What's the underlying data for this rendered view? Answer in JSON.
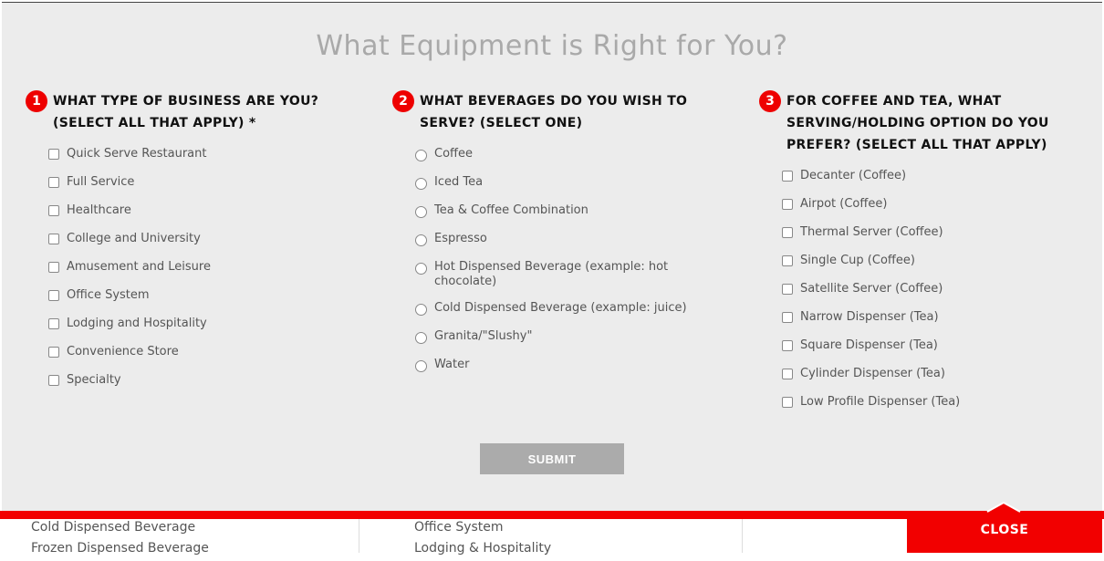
{
  "modal": {
    "title": "What Equipment is Right for You?",
    "questions": [
      {
        "number": "1",
        "text": "What type of business are you? (Select all that apply) *",
        "input_type": "checkbox",
        "options": [
          "Quick Serve Restaurant",
          "Full Service",
          "Healthcare",
          "College and University",
          "Amusement and Leisure",
          "Office System",
          "Lodging and Hospitality",
          "Convenience Store",
          "Specialty"
        ]
      },
      {
        "number": "2",
        "text": "What beverages do you wish to serve? (Select one)",
        "input_type": "radio",
        "options": [
          "Coffee",
          "Iced Tea",
          "Tea & Coffee Combination",
          "Espresso",
          "Hot Dispensed Beverage (example: hot chocolate)",
          "Cold Dispensed Beverage (example: juice)",
          "Granita/\"Slushy\"",
          "Water"
        ]
      },
      {
        "number": "3",
        "text": "For coffee and tea, what serving/holding option do you prefer? (Select all that apply)",
        "input_type": "checkbox",
        "options": [
          "Decanter (Coffee)",
          "Airpot (Coffee)",
          "Thermal Server (Coffee)",
          "Single Cup (Coffee)",
          "Satellite Server (Coffee)",
          "Narrow Dispenser (Tea)",
          "Square Dispenser (Tea)",
          "Cylinder Dispenser (Tea)",
          "Low Profile Dispenser (Tea)"
        ]
      }
    ],
    "submit_label": "SUBMIT"
  },
  "footer": {
    "close_label": "CLOSE",
    "col1": [
      "Cold Dispensed Beverage",
      "Frozen Dispensed Beverage"
    ],
    "col2": [
      "Office System",
      "Lodging & Hospitality"
    ]
  },
  "colors": {
    "accent": "#f20000",
    "modal_bg": "#ececec",
    "submit_bg": "#ababab",
    "title": "#a9a9a9"
  }
}
